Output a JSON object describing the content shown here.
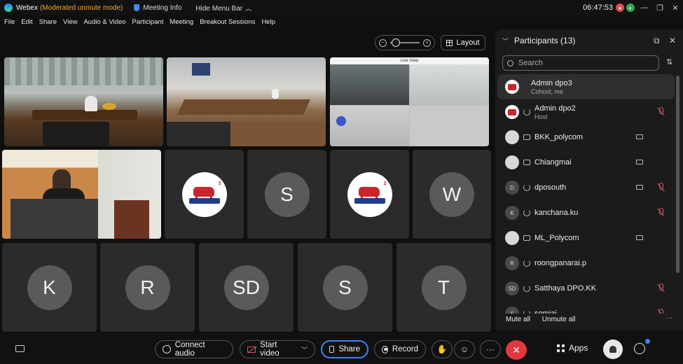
{
  "titlebar": {
    "app": "Webex",
    "mode": "(Moderated unmute mode)",
    "meeting_info": "Meeting Info",
    "hide_menu": "Hide Menu Bar",
    "time": "06:47:53"
  },
  "menu": [
    "File",
    "Edit",
    "Share",
    "View",
    "Audio & Video",
    "Participant",
    "Meeting",
    "Breakout Sessions",
    "Help"
  ],
  "toolbar": {
    "layout_label": "Layout"
  },
  "tiles": {
    "avatars": [
      "S",
      "W",
      "K",
      "R",
      "SD",
      "S",
      "T"
    ],
    "logo_text": "THAI-DENMARK",
    "live_view": "Live View"
  },
  "panel": {
    "title": "Participants (13)",
    "search_placeholder": "Search",
    "mute_all": "Mute all",
    "unmute_all": "Unmute all",
    "participants": [
      {
        "name": "Admin dpo3",
        "role": "Cohost, me",
        "avatar": ""
      },
      {
        "name": "Admin dpo2",
        "role": "Host",
        "avatar": ""
      },
      {
        "name": "BKK_polycom",
        "role": "",
        "avatar": ""
      },
      {
        "name": "Chiangmai",
        "role": "",
        "avatar": ""
      },
      {
        "name": "dposouth",
        "role": "",
        "avatar": "D"
      },
      {
        "name": "kanchana.ku",
        "role": "",
        "avatar": "K"
      },
      {
        "name": "ML_Polycom",
        "role": "",
        "avatar": ""
      },
      {
        "name": "roongpanarai.p",
        "role": "",
        "avatar": "R"
      },
      {
        "name": "Satthaya DPO.KK",
        "role": "",
        "avatar": "SD"
      },
      {
        "name": "somjai",
        "role": "",
        "avatar": "S"
      }
    ]
  },
  "controls": {
    "connect_audio": "Connect audio",
    "start_video": "Start video",
    "share": "Share",
    "record": "Record",
    "apps": "Apps",
    "more": "···"
  },
  "colors": {
    "accent": "#3b83f7",
    "end_call": "#e0383e",
    "muted": "#e25a63",
    "mode": "#f2a53a"
  }
}
